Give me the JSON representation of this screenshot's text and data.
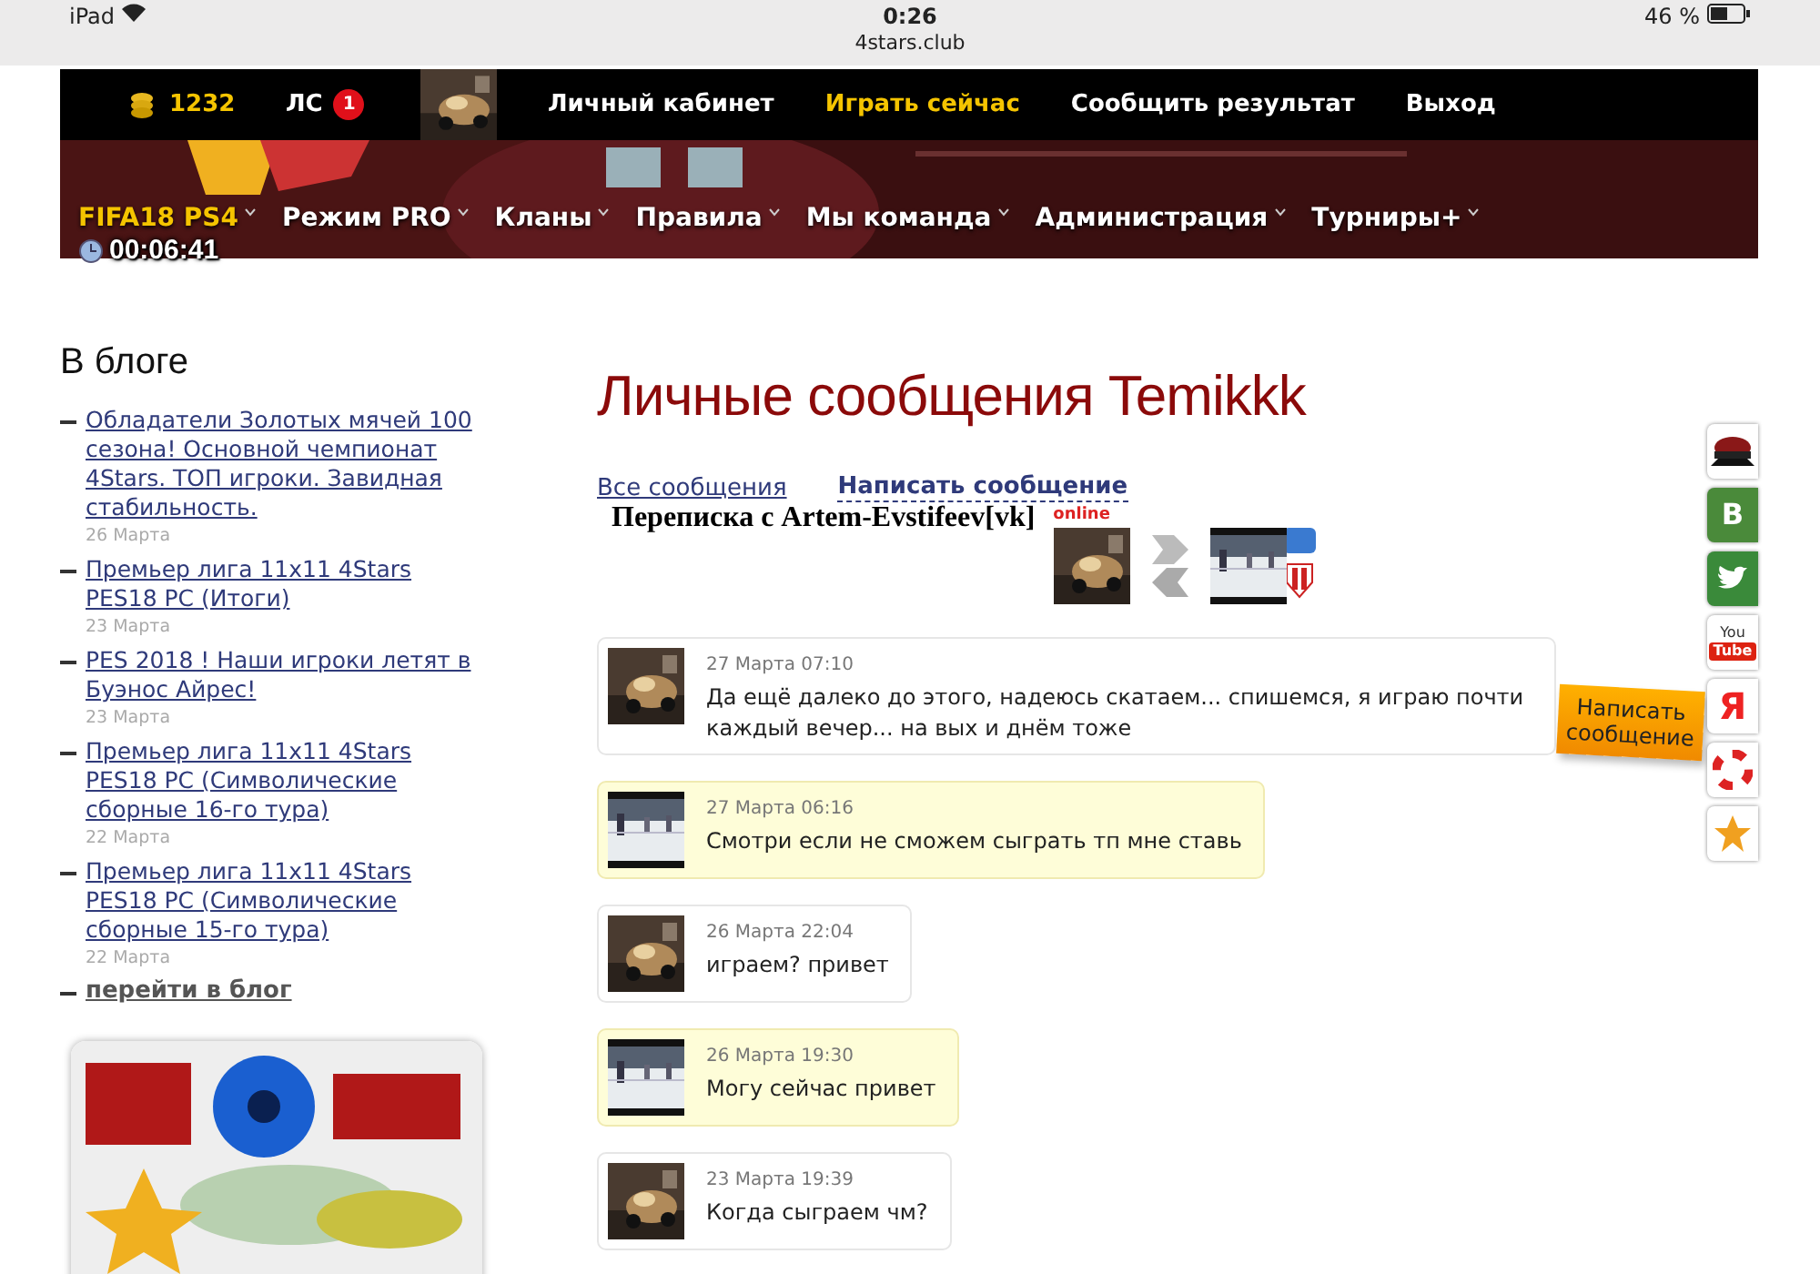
{
  "status_bar": {
    "device": "iPad",
    "time": "0:26",
    "url": "4stars.club",
    "battery": "46 %"
  },
  "top_bar": {
    "coins": "1232",
    "messages_label": "ЛС",
    "messages_badge": "1",
    "links": [
      {
        "label": "Личный кабинет",
        "selected": false
      },
      {
        "label": "Играть сейчас",
        "selected": true
      },
      {
        "label": "Сообщить результат",
        "selected": false
      },
      {
        "label": "Выход",
        "selected": false
      }
    ]
  },
  "nav": [
    {
      "label": "FIFA18 PS4",
      "selected": true
    },
    {
      "label": "Режим PRO",
      "selected": false
    },
    {
      "label": "Кланы",
      "selected": false
    },
    {
      "label": "Правила",
      "selected": false
    },
    {
      "label": "Мы команда",
      "selected": false
    },
    {
      "label": "Администрация",
      "selected": false
    },
    {
      "label": "Турниры+",
      "selected": false
    }
  ],
  "timer": "00:06:41",
  "blog": {
    "title": "В блоге",
    "posts": [
      {
        "title": "Обладатели Золотых мячей 100 сезона! Основной чемпионат 4Stars. ТОП игроки. Завидная стабильность.",
        "date": "26 Марта"
      },
      {
        "title": "Премьер лига 11х11 4Stars PES18 PC (Итоги)",
        "date": "23 Марта"
      },
      {
        "title": "PES 2018 ! Наши игроки летят в Буэнос Айрес!",
        "date": "23 Марта"
      },
      {
        "title": "Премьер лига 11х11 4Stars PES18 PC (Символические сборные 16-го тура)",
        "date": "22 Марта"
      },
      {
        "title": "Премьер лига 11х11 4Stars PES18 PC (Символические сборные 15-го тура)",
        "date": "22 Марта"
      }
    ],
    "more": "перейти в блог"
  },
  "page_title": "Личные сообщения Temikkk",
  "tabs": [
    {
      "label": "Все сообщения",
      "selected": false
    },
    {
      "label": "Написать сообщение",
      "selected": true
    }
  ],
  "conversation": {
    "title": "Переписка с Artem-Evstifeev[vk]",
    "online_label": "online"
  },
  "messages": [
    {
      "kind": "partner",
      "date": "27 Марта 07:10",
      "text": "Да ещё далеко до этого, надеюсь скатаем... спишемся, я играю почти каждый вечер... на вых и днём тоже"
    },
    {
      "kind": "own",
      "date": "27 Марта 06:16",
      "text": "Смотри если не сможем сыграть тп мне ставь"
    },
    {
      "kind": "partner",
      "date": "26 Марта 22:04",
      "text": "играем? привет"
    },
    {
      "kind": "own",
      "date": "26 Марта 19:30",
      "text": "Могу сейчас привет"
    },
    {
      "kind": "partner",
      "date": "23 Марта 19:39",
      "text": "Когда сыграем чм?"
    }
  ],
  "write_tab": "Написать сообщение",
  "social": [
    {
      "kind": "cap"
    },
    {
      "kind": "vk",
      "label": "В"
    },
    {
      "kind": "twitter"
    },
    {
      "kind": "youtube",
      "label": "You",
      "label_2": "Tube"
    },
    {
      "kind": "yandex",
      "label": "Я"
    },
    {
      "kind": "lifebuoy"
    },
    {
      "kind": "star"
    }
  ]
}
